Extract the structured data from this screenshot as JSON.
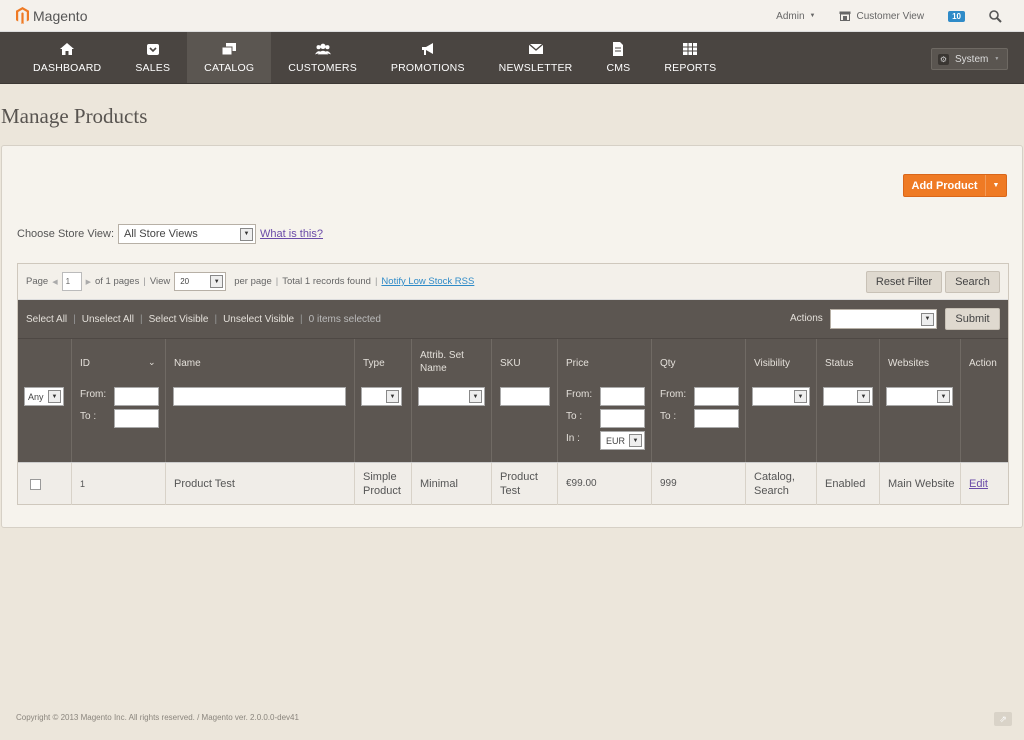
{
  "brand": {
    "name": "Magento"
  },
  "topbar": {
    "admin_label": "Admin",
    "customer_view_label": "Customer View",
    "notifications_count": "10"
  },
  "nav": {
    "items": [
      {
        "label": "DASHBOARD",
        "icon": "home-icon"
      },
      {
        "label": "SALES",
        "icon": "sales-icon"
      },
      {
        "label": "CATALOG",
        "icon": "catalog-icon"
      },
      {
        "label": "CUSTOMERS",
        "icon": "customers-icon"
      },
      {
        "label": "PROMOTIONS",
        "icon": "promotions-icon"
      },
      {
        "label": "NEWSLETTER",
        "icon": "newsletter-icon"
      },
      {
        "label": "CMS",
        "icon": "cms-icon"
      },
      {
        "label": "REPORTS",
        "icon": "reports-icon"
      }
    ],
    "system_label": "System"
  },
  "page": {
    "title": "Manage Products",
    "add_product_label": "Add Product"
  },
  "store_view": {
    "label": "Choose Store View:",
    "selected": "All Store Views",
    "help_link": "What is this?"
  },
  "pager": {
    "page_label": "Page",
    "page_value": "1",
    "of_pages": "of 1 pages",
    "view_label": "View",
    "per_page_value": "20",
    "per_page_label": "per page",
    "total": "Total 1 records found",
    "rss_link": "Notify Low Stock RSS",
    "reset_label": "Reset Filter",
    "search_label": "Search"
  },
  "massaction": {
    "select_all": "Select All",
    "unselect_all": "Unselect All",
    "select_visible": "Select Visible",
    "unselect_visible": "Unselect Visible",
    "items_selected": "0 items selected",
    "actions_label": "Actions",
    "submit_label": "Submit"
  },
  "columns": {
    "id": "ID",
    "name": "Name",
    "type": "Type",
    "attrib_set": "Attrib. Set Name",
    "sku": "SKU",
    "price": "Price",
    "qty": "Qty",
    "visibility": "Visibility",
    "status": "Status",
    "websites": "Websites",
    "action": "Action"
  },
  "filters": {
    "any": "Any",
    "from": "From:",
    "to": "To :",
    "in": "In :",
    "currency": "EUR"
  },
  "rows": [
    {
      "id": "1",
      "name": "Product Test",
      "type": "Simple Product",
      "attrib_set": "Minimal",
      "sku": "Product Test",
      "price": "€99.00",
      "qty": "999",
      "visibility": "Catalog, Search",
      "status": "Enabled",
      "websites": "Main Website",
      "action": "Edit"
    }
  ],
  "footer": {
    "copyright": "Copyright © 2013 Magento Inc. All rights reserved. / Magento ver. 2.0.0.0-dev41"
  },
  "colors": {
    "accent": "#ef7a24",
    "nav_bg": "#4a4541",
    "grid_header": "#5c5651"
  }
}
